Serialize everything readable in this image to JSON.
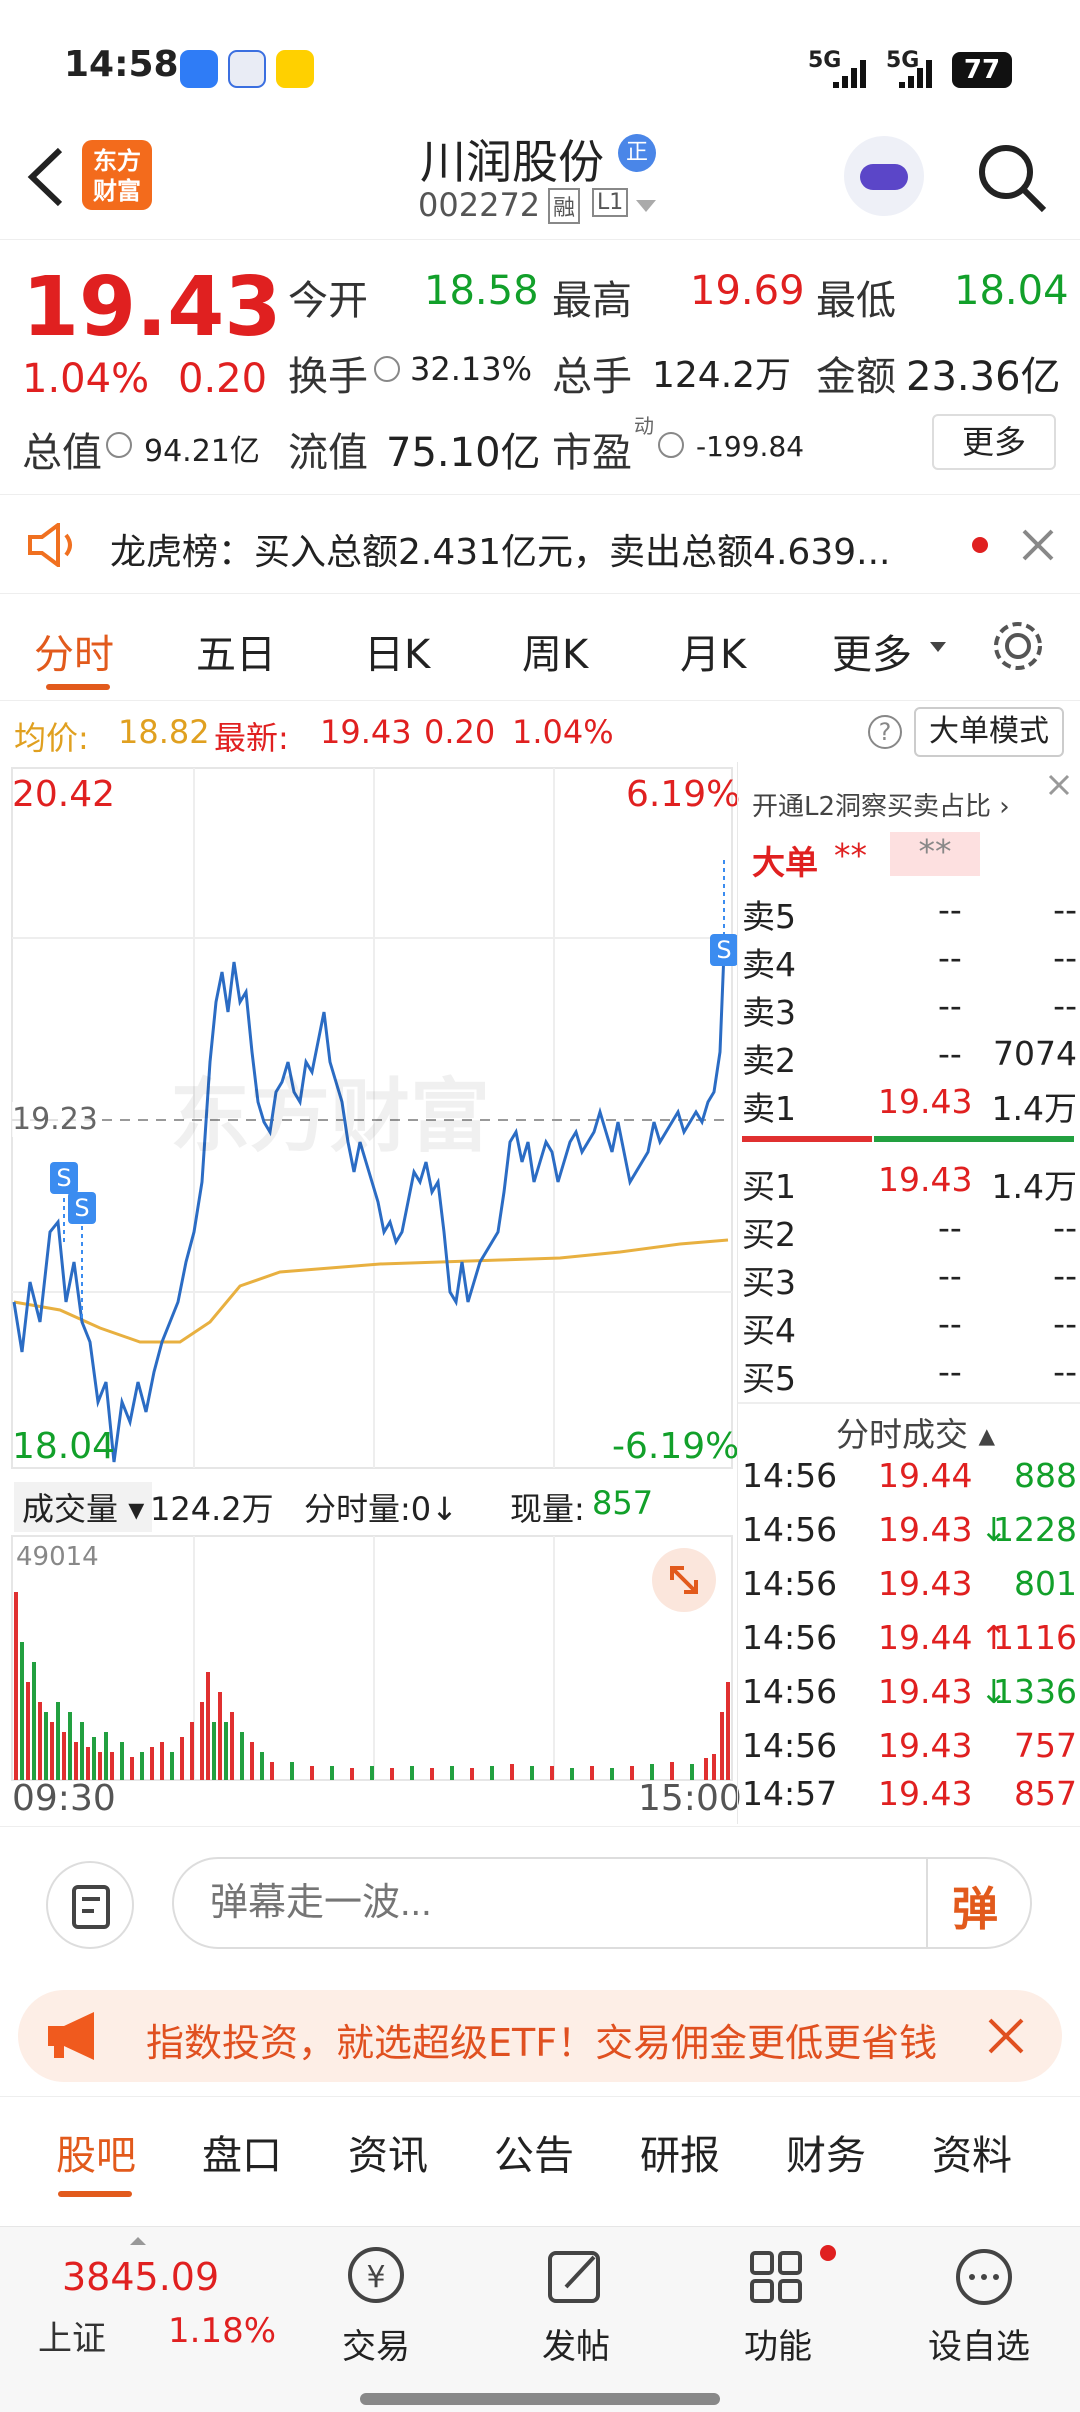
{
  "status": {
    "time": "14:58",
    "net1": "5G",
    "net2": "5G",
    "battery": "77"
  },
  "header": {
    "back_icon": "chevron-left-icon",
    "logo_line1": "东方",
    "logo_line2": "财富",
    "stock_name": "川润股份",
    "badge": "正",
    "code": "002272",
    "tag1": "融",
    "tag2": "L1"
  },
  "quote": {
    "price": "19.43",
    "change_pct": "1.04%",
    "change": "0.20",
    "open_label": "今开",
    "open": "18.58",
    "high_label": "最高",
    "high": "19.69",
    "low_label": "最低",
    "low": "18.04",
    "turnover_label": "换手",
    "turnover": "32.13%",
    "vol_label": "总手",
    "vol": "124.2万",
    "amount_label": "金额",
    "amount": "23.36亿",
    "mcap_label": "总值",
    "mcap": "94.21亿",
    "float_label": "流值",
    "float": "75.10亿",
    "pe_label": "市盈",
    "pe_sup": "动",
    "pe": "-199.84",
    "more": "更多"
  },
  "lhb": {
    "text": "龙虎榜：买入总额2.431亿元，卖出总额4.639..."
  },
  "tabs": [
    "分时",
    "五日",
    "日K",
    "周K",
    "月K",
    "更多"
  ],
  "avg": {
    "avg_label": "均价:",
    "avg": "18.82",
    "latest_label": "最新:",
    "latest": "19.43",
    "chg": "0.20",
    "pct": "1.04%",
    "mode_button": "大单模式"
  },
  "chart": {
    "y_max": "20.42",
    "y_min": "18.04",
    "pct_max": "6.19%",
    "pct_min": "-6.19%",
    "prev_close": "19.23",
    "watermark": "东方财富",
    "vol_selector": "成交量",
    "vol_total": "124.2万",
    "vol_min_label": "分时量:0↓",
    "vol_now_label": "现量:",
    "vol_now": "857",
    "vol_max": "49014",
    "time_start": "09:30",
    "time_end": "15:00"
  },
  "chart_data": {
    "type": "line",
    "series": [],
    "ylim": [
      18.04,
      20.42
    ],
    "x_range": [
      "09:30",
      "15:00"
    ],
    "prev_close": 19.23
  },
  "l2": {
    "promo": "开通L2洞察买卖占比",
    "big_label": "大单",
    "big_v1": "**",
    "big_v2": "**",
    "sell": [
      {
        "label": "卖5",
        "price": "--",
        "vol": "--"
      },
      {
        "label": "卖4",
        "price": "--",
        "vol": "--"
      },
      {
        "label": "卖3",
        "price": "--",
        "vol": "--"
      },
      {
        "label": "卖2",
        "price": "--",
        "vol": "7074"
      },
      {
        "label": "卖1",
        "price": "19.43",
        "vol": "1.4万"
      }
    ],
    "buy": [
      {
        "label": "买1",
        "price": "19.43",
        "vol": "1.4万"
      },
      {
        "label": "买2",
        "price": "--",
        "vol": "--"
      },
      {
        "label": "买3",
        "price": "--",
        "vol": "--"
      },
      {
        "label": "买4",
        "price": "--",
        "vol": "--"
      },
      {
        "label": "买5",
        "price": "--",
        "vol": "--"
      }
    ],
    "ticks_title": "分时成交",
    "ticks": [
      {
        "time": "14:56",
        "price": "19.44",
        "arrow": "",
        "vol": "888"
      },
      {
        "time": "14:56",
        "price": "19.43",
        "arrow": "↓",
        "vol": "1228"
      },
      {
        "time": "14:56",
        "price": "19.43",
        "arrow": "",
        "vol": "801"
      },
      {
        "time": "14:56",
        "price": "19.44",
        "arrow": "↑",
        "vol": "1116"
      },
      {
        "time": "14:56",
        "price": "19.43",
        "arrow": "↓",
        "vol": "1336"
      },
      {
        "time": "14:56",
        "price": "19.43",
        "arrow": "",
        "vol": "757"
      },
      {
        "time": "14:57",
        "price": "19.43",
        "arrow": "",
        "vol": "857"
      }
    ]
  },
  "danmu": {
    "placeholder": "弹幕走一波...",
    "send": "弹"
  },
  "etf": {
    "text": "指数投资，就选超级ETF！交易佣金更低更省钱"
  },
  "bottom_tabs": [
    "股吧",
    "盘口",
    "资讯",
    "公告",
    "研报",
    "财务",
    "资料"
  ],
  "bottombar": {
    "index_value": "3845.09",
    "index_name": "上证",
    "index_pct": "1.18%",
    "trade": "交易",
    "post": "发帖",
    "func": "功能",
    "fav": "设自选"
  }
}
